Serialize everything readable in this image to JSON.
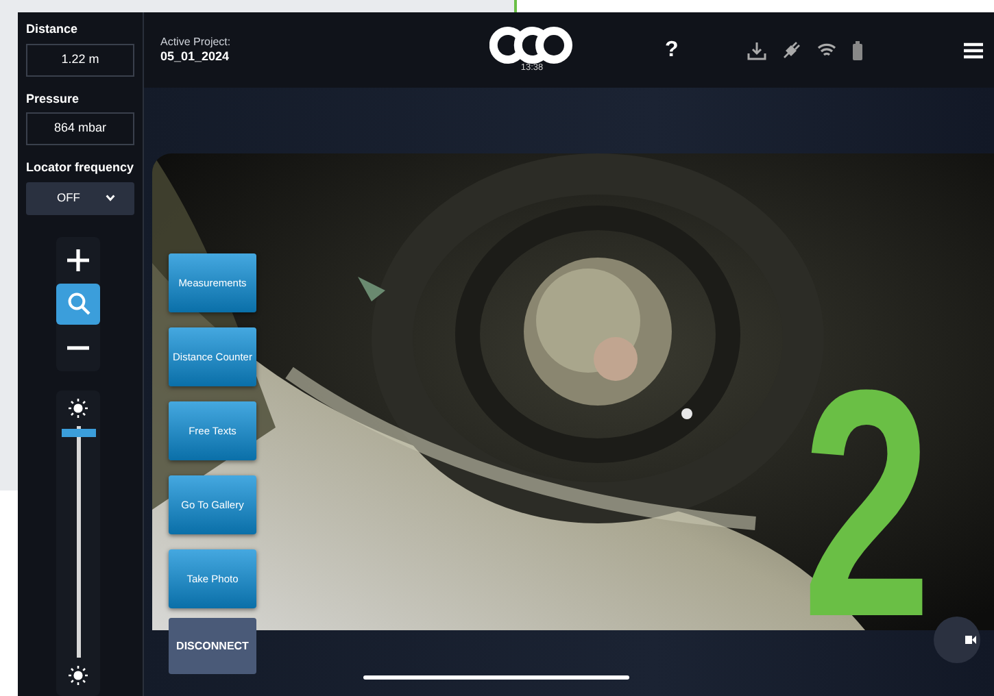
{
  "sidebar": {
    "readouts": [
      {
        "label": "Distance",
        "value": "1.22 m"
      },
      {
        "label": "Pressure",
        "value": "864 mbar"
      }
    ],
    "locator": {
      "label": "Locator frequency",
      "value": "OFF"
    },
    "zoom_tools": [
      {
        "kind": "plus",
        "selected": false
      },
      {
        "kind": "search",
        "selected": true
      },
      {
        "kind": "minus",
        "selected": false
      }
    ],
    "brightness": {
      "level": 0.97
    }
  },
  "top_bar": {
    "project_label": "Active Project:",
    "project_name": "05_01_2024",
    "time": "13:38",
    "help": "?"
  },
  "overlay_buttons": [
    "Measurements",
    "Distance Counter",
    "Free Texts",
    "Go To Gallery",
    "Take Photo"
  ],
  "disconnect": "DISCONNECT",
  "annotation": {
    "text": "2"
  }
}
